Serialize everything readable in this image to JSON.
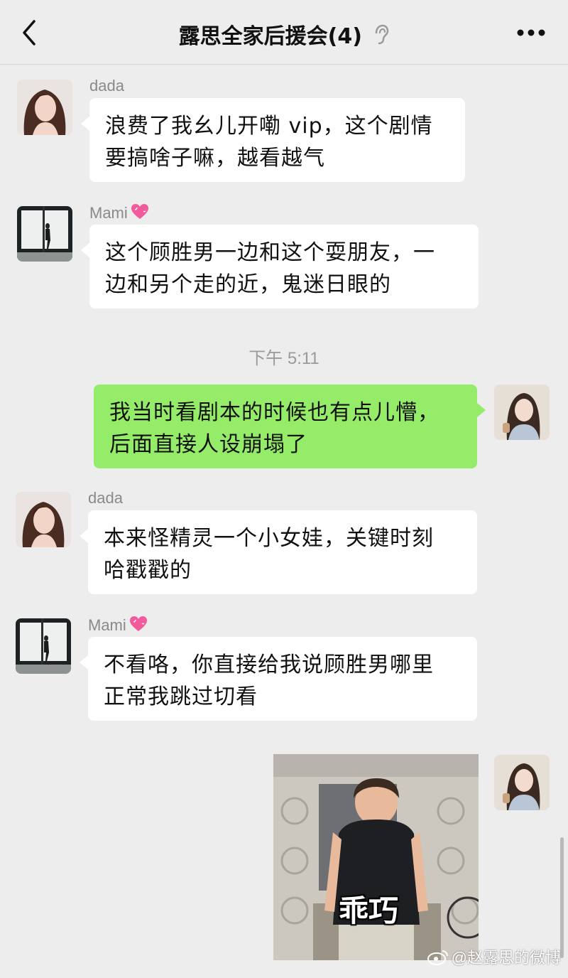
{
  "header": {
    "title": "露思全家后援会(4)",
    "icons": {
      "back": "chevron-left-icon",
      "ear": "ear-icon",
      "more": "more-dots-icon"
    }
  },
  "messages": [
    {
      "sender": "dada",
      "lines": [
        "浪费了我幺儿开嘞 vip，这个剧情",
        "要搞啥子嘛，越看越气"
      ]
    },
    {
      "sender": "Mami",
      "sender_emoji": "heart-icon",
      "lines": [
        "这个顾胜男一边和这个耍朋友，一",
        "边和另个走的近，鬼迷日眼的"
      ]
    },
    {
      "timestamp": "下午 5:11"
    },
    {
      "sender": "me",
      "lines": [
        "我当时看剧本的时候也有点儿懵，",
        "后面直接人设崩塌了"
      ]
    },
    {
      "sender": "dada",
      "lines": [
        "本来怪精灵一个小女娃，关键时刻",
        "哈戳戳的"
      ]
    },
    {
      "sender": "Mami",
      "sender_emoji": "heart-icon",
      "lines": [
        "不看咯，你直接给我说顾胜男哪里",
        "正常我跳过切看"
      ]
    },
    {
      "sender": "me",
      "sticker_caption": "乖巧"
    }
  ],
  "watermark": "@赵露思的微博",
  "colors": {
    "background": "#ededed",
    "bubble_in": "#ffffff",
    "bubble_out": "#95ec69"
  }
}
